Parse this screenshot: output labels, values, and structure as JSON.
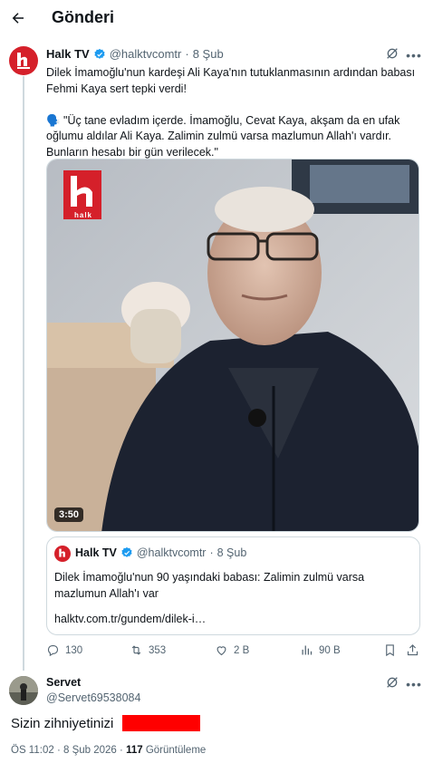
{
  "header": {
    "title": "Gönderi"
  },
  "tweet": {
    "name": "Halk TV",
    "handle": "@halktvcomtr",
    "date": "8 Şub",
    "text_line1": "Dilek İmamoğlu'nun kardeşi Ali Kaya'nın tutuklanmasının ardından babası",
    "text_line2": "Fehmi Kaya sert tepki verdi!",
    "text_line3": "🗣️ \"Üç tane evladım içerde. İmamoğlu, Cevat Kaya, akşam da en ufak",
    "text_line4": "oğlumu aldılar Ali Kaya. Zalimin zulmü varsa mazlumun Allah'ı vardır.",
    "text_line5": "Bunların hesabı bir gün verilecek.\"",
    "video": {
      "duration": "3:50",
      "logo_text": "halk"
    },
    "card": {
      "name": "Halk TV",
      "handle": "@halktvcomtr",
      "date": "8 Şub",
      "text_line1": "Dilek İmamoğlu'nun 90 yaşındaki babası: Zalimin zulmü varsa",
      "text_line2": "mazlumun Allah'ı var",
      "url": "halktv.com.tr/gundem/dilek-i…"
    },
    "actions": {
      "replies": "130",
      "reposts": "353",
      "likes": "2 B",
      "views": "90 B"
    }
  },
  "reply": {
    "name": "Servet",
    "handle": "@Servet69538084",
    "text": "Sizin zihniyetinizi",
    "time": "ÖS 11:02",
    "date": "8 Şub 2026",
    "views_count": "117",
    "views_label": "Görüntüleme"
  },
  "colors": {
    "brand_red": "#d5202a",
    "verified_blue": "#1d9bf0",
    "muted": "#536471",
    "redaction": "#ff0000"
  }
}
